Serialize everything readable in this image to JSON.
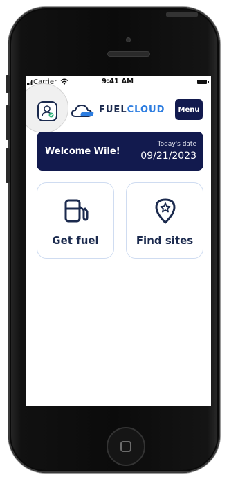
{
  "status_bar": {
    "carrier": "Carrier",
    "time": "9:41 AM"
  },
  "header": {
    "logo_main": "FUEL",
    "logo_accent": "CLOUD",
    "menu_label": "Menu"
  },
  "welcome": {
    "greeting": "Welcome Wile!",
    "date_label": "Today's date",
    "date_value": "09/21/2023"
  },
  "tiles": [
    {
      "label": "Get fuel",
      "icon": "fuel-pump-icon"
    },
    {
      "label": "Find sites",
      "icon": "location-star-icon"
    }
  ],
  "colors": {
    "navy": "#121a4e",
    "brand_blue": "#2d7de0",
    "tile_border": "#cfdcf1"
  }
}
